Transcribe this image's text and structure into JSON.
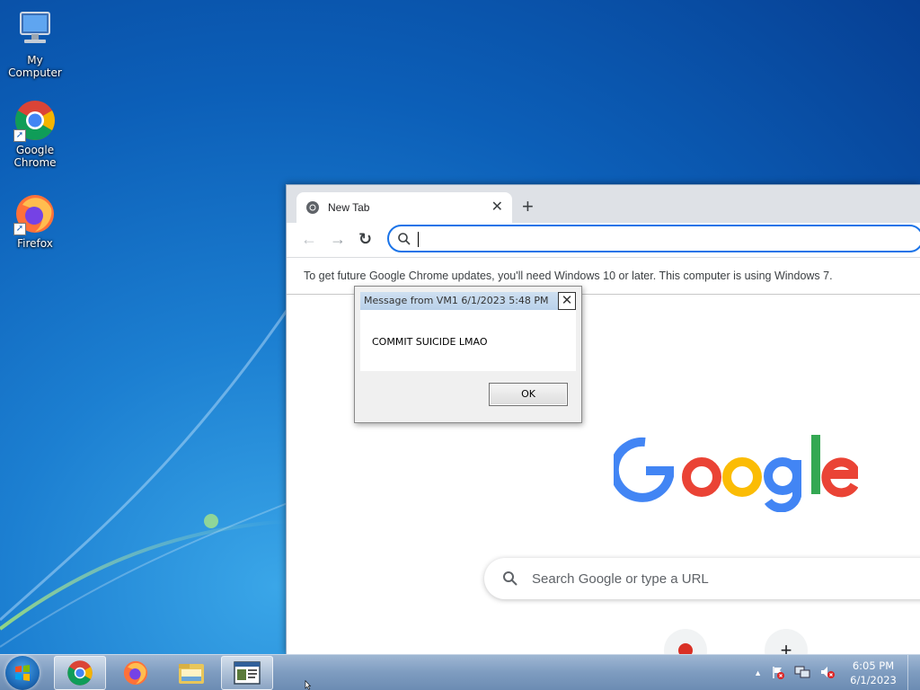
{
  "desktop": {
    "icons": [
      {
        "label": "My Computer",
        "icon": "computer-icon"
      },
      {
        "label": "Google Chrome",
        "icon": "chrome-icon"
      },
      {
        "label": "Firefox",
        "icon": "firefox-icon"
      }
    ]
  },
  "chrome": {
    "tab": {
      "title": "New Tab",
      "favicon": "chrome-icon",
      "close": "✕"
    },
    "new_tab": "+",
    "nav": {
      "back": "←",
      "forward": "→",
      "reload": "↻"
    },
    "omnibox": {
      "value": ""
    },
    "infobar": {
      "text": "To get future Google Chrome updates, you'll need Windows 10 or later. This computer is using Windows 7."
    },
    "ntp": {
      "search_placeholder": "Search Google or type a URL",
      "shortcut_add": "+"
    }
  },
  "dialog": {
    "title": "Message from VM1 6/1/2023 5:48 PM",
    "close": "✕",
    "message": "COMMIT SUICIDE LMAO",
    "ok_label": "OK"
  },
  "taskbar": {
    "pinned": [
      "chrome-icon",
      "firefox-icon",
      "folder-icon",
      "app-window-icon"
    ],
    "tray": {
      "show_hidden": "▲",
      "icons": [
        "action-center-flag-icon",
        "network-icon",
        "volume-muted-icon"
      ]
    },
    "clock": {
      "time": "6:05 PM",
      "date": "6/1/2023"
    }
  },
  "colors": {
    "accent": "#1a73e8",
    "taskbar": "#7e9cc0",
    "google_blue": "#4285F4",
    "google_red": "#EA4335",
    "google_yellow": "#FBBC05",
    "google_green": "#34A853"
  }
}
